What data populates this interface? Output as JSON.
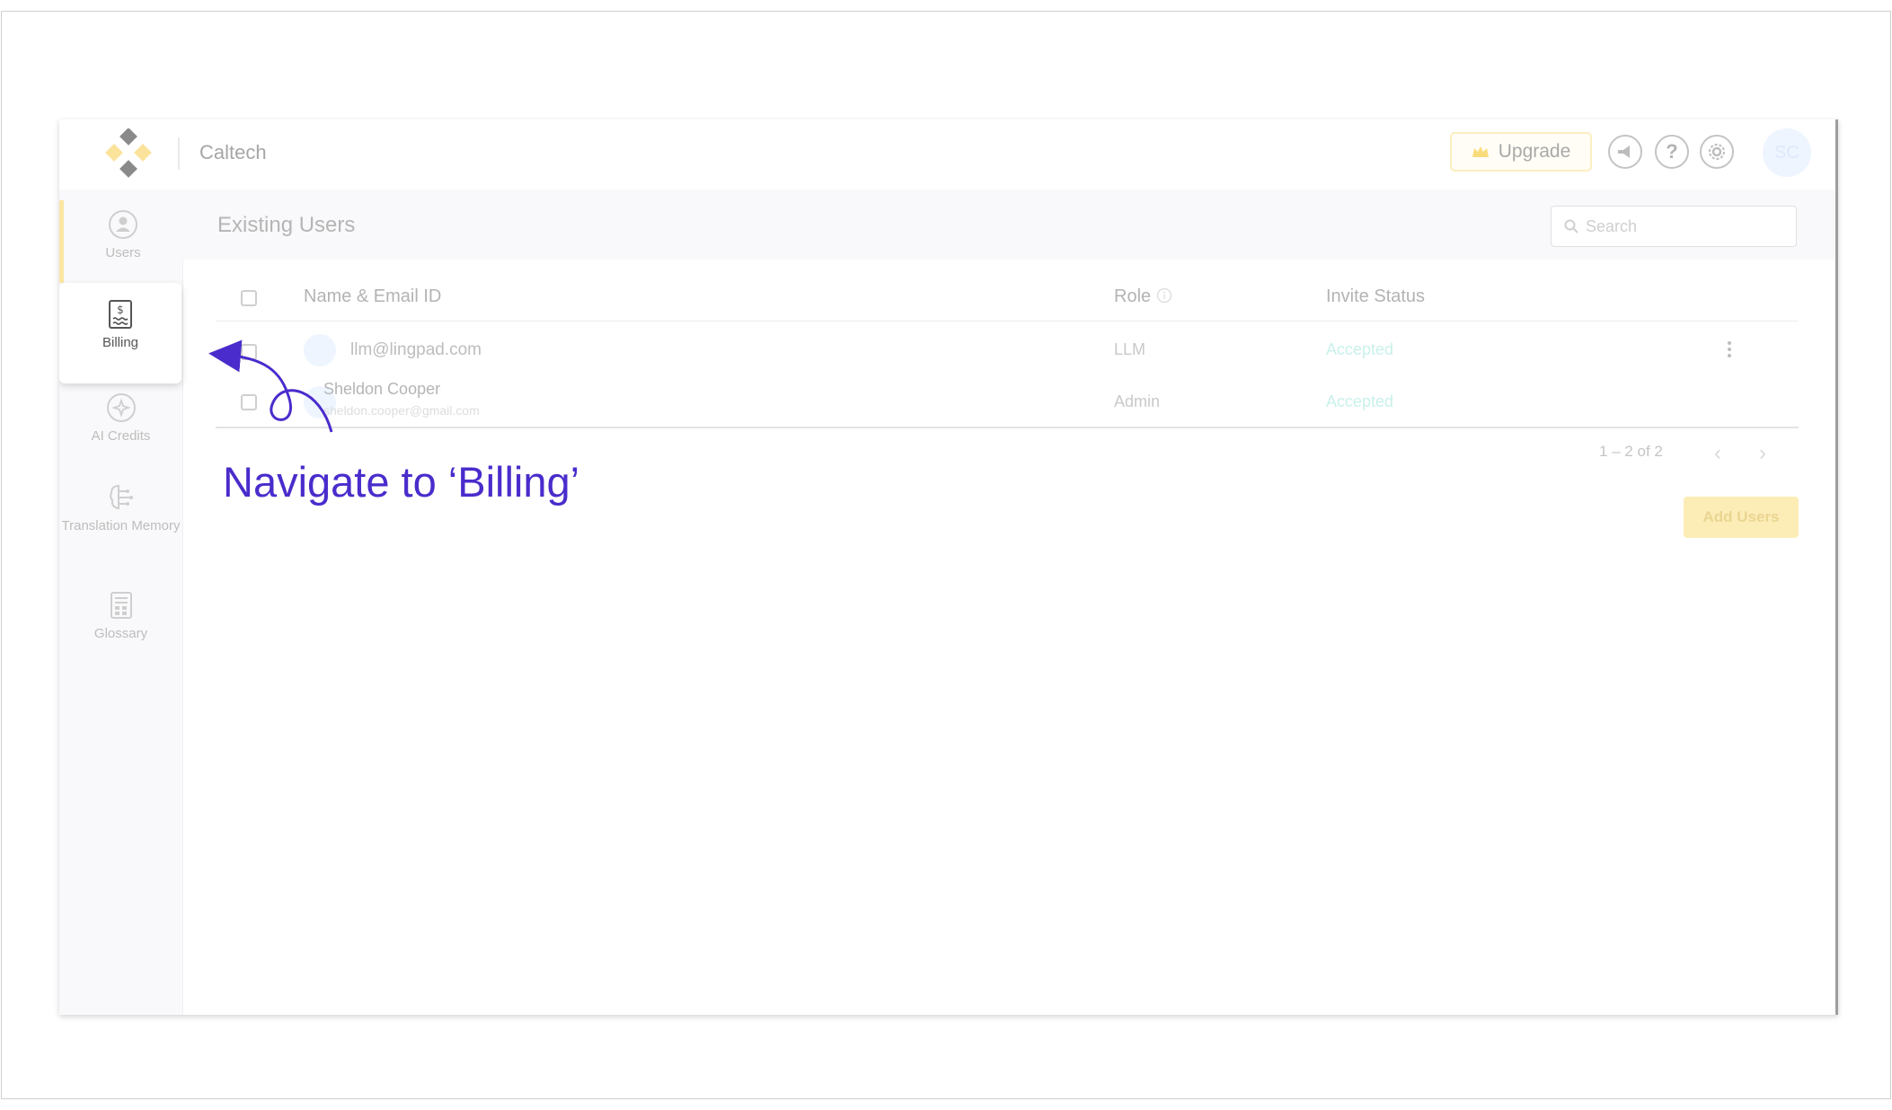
{
  "header": {
    "org_name": "Caltech",
    "upgrade_label": "Upgrade",
    "avatar_initials": "SC"
  },
  "sidebar": {
    "items": [
      {
        "label": "Users"
      },
      {
        "label": "Billing"
      },
      {
        "label": "AI Credits"
      },
      {
        "label": "Translation Memory"
      },
      {
        "label": "Glossary"
      }
    ]
  },
  "main": {
    "title": "Existing Users",
    "search_placeholder": "Search",
    "columns": [
      "Name & Email ID",
      "Role",
      "Invite Status"
    ],
    "rows": [
      {
        "name": "llm@lingpad.com",
        "email": "",
        "role": "LLM",
        "status": "Accepted"
      },
      {
        "name": "Sheldon Cooper",
        "email": "sheldon.cooper@gmail.com",
        "role": "Admin",
        "status": "Accepted"
      }
    ],
    "pagination": "1 – 2 of 2",
    "add_users_label": "Add Users"
  },
  "annotation": {
    "text": "Navigate to ‘Billing’"
  },
  "colors": {
    "brand_yellow": "#fbe6a4",
    "annotation_purple": "#4a2ccc",
    "accepted_teal": "#c9f1eb"
  },
  "icons": [
    "logo-icon",
    "crown-icon",
    "megaphone-icon",
    "help-icon",
    "settings-icon",
    "users-icon",
    "billing-icon",
    "ai-credits-icon",
    "translation-memory-icon",
    "glossary-icon",
    "search-icon",
    "info-icon",
    "more-vertical-icon",
    "chevron-left-icon",
    "chevron-right-icon"
  ]
}
